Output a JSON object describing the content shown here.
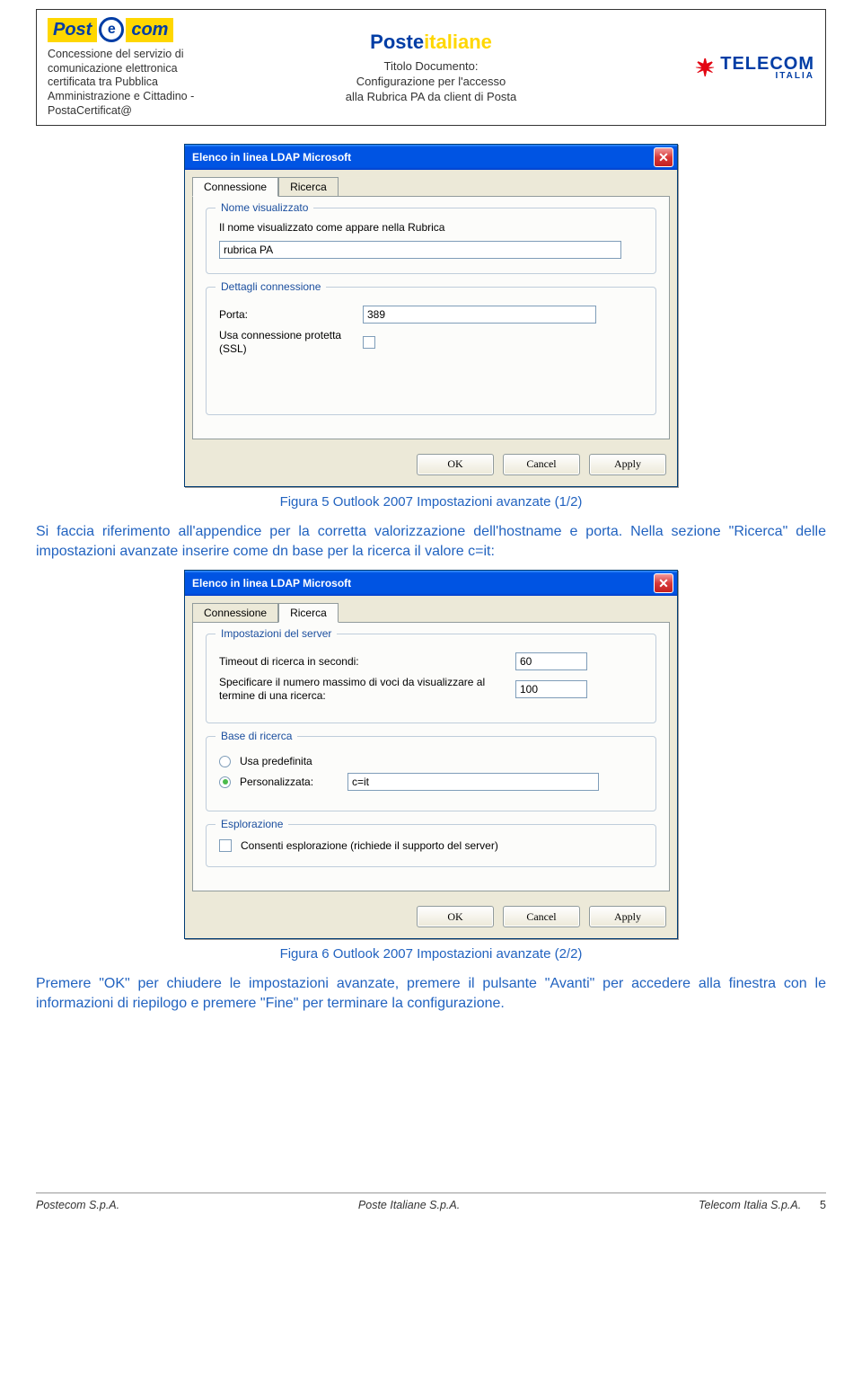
{
  "header": {
    "logo_postecom": {
      "post": "Post",
      "e": "e",
      "com": "com"
    },
    "concession_lines": "Concessione del servizio di\ncomunicazione elettronica\ncertificata tra Pubblica\nAmministrazione e Cittadino -\nPostaCertificat@",
    "logo_posteitaliane": {
      "poste": "Poste",
      "italiane": "italiane"
    },
    "doc_title_label": "Titolo Documento:",
    "doc_title_line1": "Configurazione per l'accesso",
    "doc_title_line2": "alla Rubrica PA da client di Posta",
    "logo_telecom": {
      "name": "TELECOM",
      "sub": "ITALIA"
    }
  },
  "dialog1": {
    "title": "Elenco in linea LDAP Microsoft",
    "tab_connection": "Connessione",
    "tab_search": "Ricerca",
    "group_name": "Nome visualizzato",
    "name_desc": "Il nome visualizzato come appare nella Rubrica",
    "name_value": "rubrica PA",
    "group_conn": "Dettagli connessione",
    "port_label": "Porta:",
    "port_value": "389",
    "ssl_label": "Usa connessione protetta (SSL)",
    "btn_ok": "OK",
    "btn_cancel": "Cancel",
    "btn_apply": "Apply"
  },
  "caption1": "Figura 5 Outlook 2007 Impostazioni avanzate (1/2)",
  "para1": "Si faccia riferimento all'appendice per la corretta valorizzazione dell'hostname e porta. Nella sezione \"Ricerca\" delle impostazioni avanzate inserire come dn base per la ricerca il valore c=it:",
  "dialog2": {
    "title": "Elenco in linea LDAP Microsoft",
    "tab_connection": "Connessione",
    "tab_search": "Ricerca",
    "group_server": "Impostazioni del server",
    "timeout_label": "Timeout di ricerca in secondi:",
    "timeout_value": "60",
    "maxentries_label": "Specificare il numero massimo di voci da visualizzare al termine di una ricerca:",
    "maxentries_value": "100",
    "group_base": "Base di ricerca",
    "radio_default": "Usa predefinita",
    "radio_custom": "Personalizzata:",
    "custom_value": "c=it",
    "group_browse": "Esplorazione",
    "browse_check_label": "Consenti esplorazione (richiede il supporto del server)",
    "btn_ok": "OK",
    "btn_cancel": "Cancel",
    "btn_apply": "Apply"
  },
  "caption2": "Figura 6 Outlook 2007 Impostazioni avanzate (2/2)",
  "para2": "Premere \"OK\" per chiudere le impostazioni avanzate, premere il pulsante \"Avanti\" per accedere alla finestra con le informazioni di riepilogo e premere \"Fine\" per terminare la configurazione.",
  "footer": {
    "left": "Postecom  S.p.A.",
    "center": "Poste Italiane S.p.A.",
    "right": "Telecom Italia S.p.A.",
    "page": "5"
  }
}
